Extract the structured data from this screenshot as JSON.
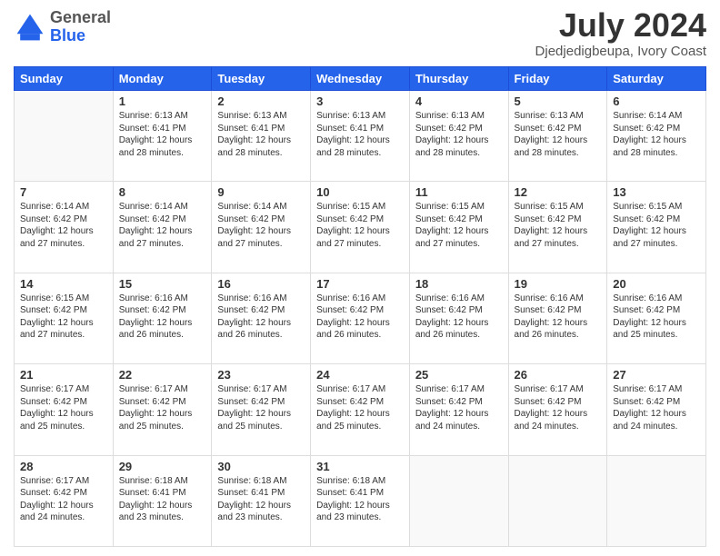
{
  "header": {
    "logo": {
      "general": "General",
      "blue": "Blue"
    },
    "title": "July 2024",
    "location": "Djedjedigbeupa, Ivory Coast"
  },
  "days_of_week": [
    "Sunday",
    "Monday",
    "Tuesday",
    "Wednesday",
    "Thursday",
    "Friday",
    "Saturday"
  ],
  "weeks": [
    [
      {
        "day": "",
        "info": ""
      },
      {
        "day": "1",
        "info": "Sunrise: 6:13 AM\nSunset: 6:41 PM\nDaylight: 12 hours\nand 28 minutes."
      },
      {
        "day": "2",
        "info": "Sunrise: 6:13 AM\nSunset: 6:41 PM\nDaylight: 12 hours\nand 28 minutes."
      },
      {
        "day": "3",
        "info": "Sunrise: 6:13 AM\nSunset: 6:41 PM\nDaylight: 12 hours\nand 28 minutes."
      },
      {
        "day": "4",
        "info": "Sunrise: 6:13 AM\nSunset: 6:42 PM\nDaylight: 12 hours\nand 28 minutes."
      },
      {
        "day": "5",
        "info": "Sunrise: 6:13 AM\nSunset: 6:42 PM\nDaylight: 12 hours\nand 28 minutes."
      },
      {
        "day": "6",
        "info": "Sunrise: 6:14 AM\nSunset: 6:42 PM\nDaylight: 12 hours\nand 28 minutes."
      }
    ],
    [
      {
        "day": "7",
        "info": "Sunrise: 6:14 AM\nSunset: 6:42 PM\nDaylight: 12 hours\nand 27 minutes."
      },
      {
        "day": "8",
        "info": "Sunrise: 6:14 AM\nSunset: 6:42 PM\nDaylight: 12 hours\nand 27 minutes."
      },
      {
        "day": "9",
        "info": "Sunrise: 6:14 AM\nSunset: 6:42 PM\nDaylight: 12 hours\nand 27 minutes."
      },
      {
        "day": "10",
        "info": "Sunrise: 6:15 AM\nSunset: 6:42 PM\nDaylight: 12 hours\nand 27 minutes."
      },
      {
        "day": "11",
        "info": "Sunrise: 6:15 AM\nSunset: 6:42 PM\nDaylight: 12 hours\nand 27 minutes."
      },
      {
        "day": "12",
        "info": "Sunrise: 6:15 AM\nSunset: 6:42 PM\nDaylight: 12 hours\nand 27 minutes."
      },
      {
        "day": "13",
        "info": "Sunrise: 6:15 AM\nSunset: 6:42 PM\nDaylight: 12 hours\nand 27 minutes."
      }
    ],
    [
      {
        "day": "14",
        "info": "Sunrise: 6:15 AM\nSunset: 6:42 PM\nDaylight: 12 hours\nand 27 minutes."
      },
      {
        "day": "15",
        "info": "Sunrise: 6:16 AM\nSunset: 6:42 PM\nDaylight: 12 hours\nand 26 minutes."
      },
      {
        "day": "16",
        "info": "Sunrise: 6:16 AM\nSunset: 6:42 PM\nDaylight: 12 hours\nand 26 minutes."
      },
      {
        "day": "17",
        "info": "Sunrise: 6:16 AM\nSunset: 6:42 PM\nDaylight: 12 hours\nand 26 minutes."
      },
      {
        "day": "18",
        "info": "Sunrise: 6:16 AM\nSunset: 6:42 PM\nDaylight: 12 hours\nand 26 minutes."
      },
      {
        "day": "19",
        "info": "Sunrise: 6:16 AM\nSunset: 6:42 PM\nDaylight: 12 hours\nand 26 minutes."
      },
      {
        "day": "20",
        "info": "Sunrise: 6:16 AM\nSunset: 6:42 PM\nDaylight: 12 hours\nand 25 minutes."
      }
    ],
    [
      {
        "day": "21",
        "info": "Sunrise: 6:17 AM\nSunset: 6:42 PM\nDaylight: 12 hours\nand 25 minutes."
      },
      {
        "day": "22",
        "info": "Sunrise: 6:17 AM\nSunset: 6:42 PM\nDaylight: 12 hours\nand 25 minutes."
      },
      {
        "day": "23",
        "info": "Sunrise: 6:17 AM\nSunset: 6:42 PM\nDaylight: 12 hours\nand 25 minutes."
      },
      {
        "day": "24",
        "info": "Sunrise: 6:17 AM\nSunset: 6:42 PM\nDaylight: 12 hours\nand 25 minutes."
      },
      {
        "day": "25",
        "info": "Sunrise: 6:17 AM\nSunset: 6:42 PM\nDaylight: 12 hours\nand 24 minutes."
      },
      {
        "day": "26",
        "info": "Sunrise: 6:17 AM\nSunset: 6:42 PM\nDaylight: 12 hours\nand 24 minutes."
      },
      {
        "day": "27",
        "info": "Sunrise: 6:17 AM\nSunset: 6:42 PM\nDaylight: 12 hours\nand 24 minutes."
      }
    ],
    [
      {
        "day": "28",
        "info": "Sunrise: 6:17 AM\nSunset: 6:42 PM\nDaylight: 12 hours\nand 24 minutes."
      },
      {
        "day": "29",
        "info": "Sunrise: 6:18 AM\nSunset: 6:41 PM\nDaylight: 12 hours\nand 23 minutes."
      },
      {
        "day": "30",
        "info": "Sunrise: 6:18 AM\nSunset: 6:41 PM\nDaylight: 12 hours\nand 23 minutes."
      },
      {
        "day": "31",
        "info": "Sunrise: 6:18 AM\nSunset: 6:41 PM\nDaylight: 12 hours\nand 23 minutes."
      },
      {
        "day": "",
        "info": ""
      },
      {
        "day": "",
        "info": ""
      },
      {
        "day": "",
        "info": ""
      }
    ]
  ]
}
